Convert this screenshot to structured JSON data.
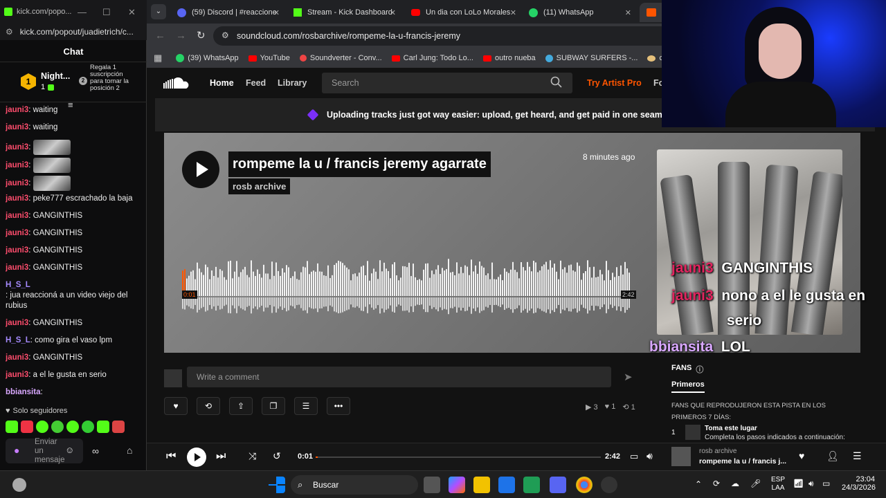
{
  "chat_window": {
    "url_title": "kick.com/popo...",
    "url": "kick.com/popout/juadietrich/c...",
    "header": "Chat",
    "gift": {
      "name": "Night...",
      "count": "1",
      "rank": "2",
      "text": "Regala 1 suscripción para tomar la posición 2"
    },
    "messages": [
      {
        "user": "jauni3",
        "text": ": waiting",
        "user_color": "#ff4d6d"
      },
      {
        "user": "jauni3",
        "text": ": waiting",
        "user_color": "#ff4d6d"
      },
      {
        "user": "jauni3",
        "text": ":",
        "user_color": "#ff4d6d",
        "sticker": true
      },
      {
        "user": "jauni3",
        "text": ":",
        "user_color": "#ff4d6d",
        "sticker": true
      },
      {
        "user": "jauni3",
        "text": ":",
        "user_color": "#ff4d6d",
        "sticker": true
      },
      {
        "user": "jauni3",
        "text": ": peke777 escrachado la baja",
        "user_color": "#ff4d6d"
      },
      {
        "user": "jauni3",
        "text": ": GANGINTHIS",
        "user_color": "#ff4d6d"
      },
      {
        "user": "jauni3",
        "text": ": GANGINTHIS",
        "user_color": "#ff4d6d"
      },
      {
        "user": "jauni3",
        "text": ": GANGINTHIS",
        "user_color": "#ff4d6d"
      },
      {
        "user": "jauni3",
        "text": ": GANGINTHIS",
        "user_color": "#ff4d6d"
      },
      {
        "user": "H_S_L",
        "text": ": jua reaccioná a un video viejo del rubius",
        "user_color": "#a68bff"
      },
      {
        "user": "jauni3",
        "text": ": GANGINTHIS",
        "user_color": "#ff4d6d"
      },
      {
        "user": "H_S_L",
        "text": ": como gira el vaso lpm",
        "user_color": "#a68bff"
      },
      {
        "user": "jauni3",
        "text": ": GANGINTHIS",
        "user_color": "#ff4d6d"
      },
      {
        "user": "jauni3",
        "text": ": a el le gusta en serio",
        "user_color": "#ff4d6d"
      },
      {
        "user": "bbiansita",
        "text": ":",
        "user_color": "#d9a8ff"
      }
    ],
    "followers_only": "Solo seguidores",
    "send_placeholder": "Enviar un mensaje"
  },
  "tabs": [
    {
      "label": "(59) Discord | #reaccione",
      "color": "#5865f2"
    },
    {
      "label": "Stream - Kick Dashboard",
      "color": "#53fc18"
    },
    {
      "label": "Un dia con LoLo Morales",
      "color": "#ff0000"
    },
    {
      "label": "(11) WhatsApp",
      "color": "#25d366"
    }
  ],
  "address": "soundcloud.com/rosbarchive/rompeme-la-u-francis-jeremy",
  "bookmarks": [
    "(39) WhatsApp",
    "YouTube",
    "Soundverter - Conv...",
    "Carl Jung: Todo Lo...",
    "outro nueba",
    "SUBWAY SURFERS -...",
    "compran"
  ],
  "sc_nav": {
    "home": "Home",
    "feed": "Feed",
    "library": "Library",
    "search_placeholder": "Search",
    "try_pro": "Try Artist Pro",
    "for": "Fo"
  },
  "banner": "Uploading tracks just got way easier: upload, get heard, and get paid in one seamless experien",
  "track": {
    "title": "rompeme la u / francis jeremy agarrate",
    "artist": "rosb archive",
    "posted": "8 minutes ago",
    "current": "0:01",
    "duration": "2:42",
    "progress": 0.006
  },
  "comment_placeholder": "Write a comment",
  "stats": {
    "plays": "3",
    "likes": "1",
    "reposts": "1"
  },
  "fans": {
    "title": "FANS",
    "tab": "Primeros",
    "desc": "FANS QUE REPRODUJERON ESTA PISTA EN LOS PRIMEROS 7 DÍAS:",
    "rank": "1",
    "item_title": "Toma este lugar",
    "item_sub": "Completa los pasos indicados a continuación:"
  },
  "player": {
    "current": "0:01",
    "duration": "2:42",
    "artist": "rosb archive",
    "title": "rompeme la u / francis j..."
  },
  "overlay_chat": [
    {
      "user": "jauni3",
      "text": "GANGINTHIS"
    },
    {
      "user": "jauni3",
      "text": "nono a el le gusta en"
    },
    {
      "user": "",
      "text": "serio"
    },
    {
      "user": "bbiansita",
      "text": "LOL"
    }
  ],
  "taskbar": {
    "search": "Buscar",
    "lang1": "ESP",
    "lang2": "LAA",
    "time": "23:04",
    "date": "24/3/2026"
  }
}
